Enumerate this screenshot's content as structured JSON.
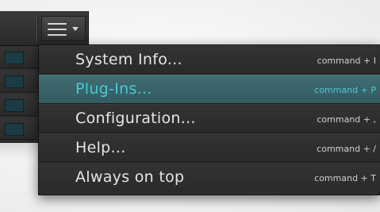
{
  "toolbar": {
    "menu_icon": "hamburger-icon",
    "caret_icon": "caret-down-icon"
  },
  "menu": {
    "items": [
      {
        "label": "System Info...",
        "shortcut": "command + I"
      },
      {
        "label": "Plug-Ins...",
        "shortcut": "command + P",
        "highlighted": true
      },
      {
        "label": "Configuration...",
        "shortcut": "command + ,"
      },
      {
        "label": "Help...",
        "shortcut": "command + /"
      },
      {
        "label": "Always on top",
        "shortcut": "command + T"
      }
    ]
  },
  "colors": {
    "menu_background": "#2e2e2e",
    "highlight_background": "#3f6c72",
    "highlight_text": "#4ec8d6",
    "text": "#e6e6e6"
  }
}
